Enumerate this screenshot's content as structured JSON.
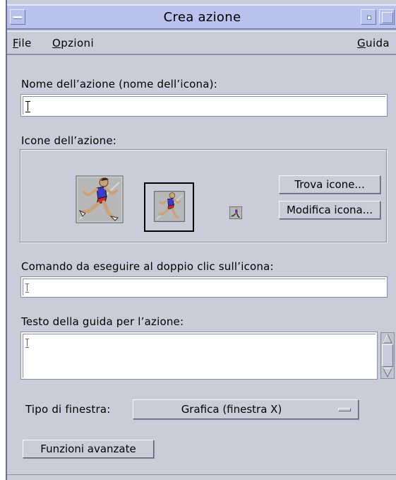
{
  "window": {
    "title": "Crea azione"
  },
  "menubar": {
    "file_mnemonic": "F",
    "file_rest": "ile",
    "options_mnemonic": "O",
    "options_rest": "pzioni",
    "help_mnemonic": "G",
    "help_rest": "uida"
  },
  "form": {
    "action_name_label": "Nome dell’azione (nome dell’icona):",
    "action_name_value": "",
    "icons_label": "Icone dell’azione:",
    "find_icons_button": "Trova icone...",
    "edit_icon_button": "Modifica icona...",
    "command_label": "Comando da eseguire al doppio clic sull’icona:",
    "command_value": "",
    "help_text_label": "Testo della guida per l’azione:",
    "help_text_value": "",
    "window_type_label": "Tipo di finestra:",
    "window_type_value": "Grafica (finestra X)",
    "advanced_button": "Funzioni avanzate"
  },
  "icons": {
    "large": "runner-icon-large",
    "medium": "runner-icon-medium",
    "small": "runner-icon-small"
  },
  "colors": {
    "titlebar": "#b9c2ec",
    "window_bg": "#cacdd9",
    "field_bg": "#ffffff"
  }
}
